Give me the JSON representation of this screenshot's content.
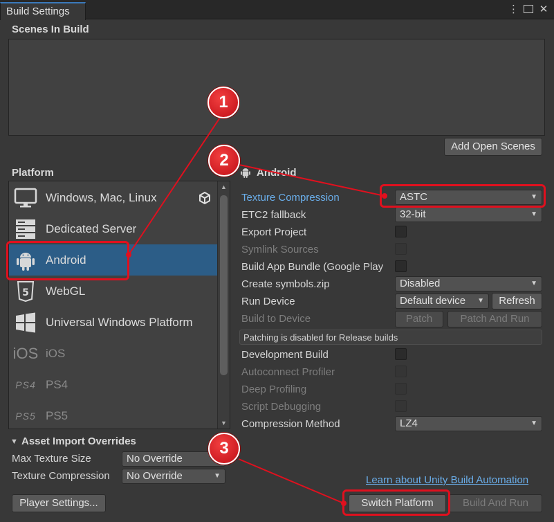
{
  "window": {
    "title": "Build Settings",
    "menu_icon": "kebab-menu-icon",
    "maximize_icon": "maximize-icon",
    "close_icon": "close-icon"
  },
  "scenes": {
    "heading": "Scenes In Build",
    "add_open_scenes": "Add Open Scenes"
  },
  "platform": {
    "heading": "Platform",
    "items": [
      {
        "label": "Windows, Mac, Linux",
        "icon": "monitor-icon",
        "badge": "unity-logo-icon"
      },
      {
        "label": "Dedicated Server",
        "icon": "server-icon"
      },
      {
        "label": "Android",
        "icon": "android-icon",
        "selected": true
      },
      {
        "label": "WebGL",
        "icon": "html5-icon"
      },
      {
        "label": "Universal Windows Platform",
        "icon": "windows-logo-icon"
      },
      {
        "label": "iOS",
        "icon": "ios-icon",
        "icon_text": "iOS",
        "dim": true
      },
      {
        "label": "PS4",
        "icon": "ps4-icon",
        "icon_text": "PS4",
        "dim": true
      },
      {
        "label": "PS5",
        "icon": "ps5-icon",
        "icon_text": "PS5",
        "dim": true
      }
    ]
  },
  "settings": {
    "platform_title": "Android",
    "texture_compression": {
      "label": "Texture Compression",
      "value": "ASTC"
    },
    "etc2_fallback": {
      "label": "ETC2 fallback",
      "value": "32-bit"
    },
    "export_project": {
      "label": "Export Project"
    },
    "symlink_sources": {
      "label": "Symlink Sources"
    },
    "build_app_bundle": {
      "label": "Build App Bundle (Google Play"
    },
    "create_symbols": {
      "label": "Create symbols.zip",
      "value": "Disabled"
    },
    "run_device": {
      "label": "Run Device",
      "value": "Default device",
      "refresh": "Refresh"
    },
    "build_to_device": {
      "label": "Build to Device",
      "patch": "Patch",
      "patch_and_run": "Patch And Run"
    },
    "patching_info": "Patching is disabled for Release builds",
    "development_build": {
      "label": "Development Build"
    },
    "autoconnect_profiler": {
      "label": "Autoconnect Profiler"
    },
    "deep_profiling": {
      "label": "Deep Profiling"
    },
    "script_debugging": {
      "label": "Script Debugging"
    },
    "compression_method": {
      "label": "Compression Method",
      "value": "LZ4"
    }
  },
  "asset_import": {
    "heading": "Asset Import Overrides",
    "max_texture_size": {
      "label": "Max Texture Size",
      "value": "No Override"
    },
    "texture_compression": {
      "label": "Texture Compression",
      "value": "No Override"
    }
  },
  "footer": {
    "learn_link": "Learn about Unity Build Automation",
    "player_settings": "Player Settings...",
    "switch_platform": "Switch Platform",
    "build_and_run": "Build And Run"
  },
  "annotations": {
    "markers": [
      "1",
      "2",
      "3"
    ],
    "color": "#e0101e"
  },
  "colors": {
    "background": "#383838",
    "selection": "#2c5d87",
    "link": "#6aaeea"
  }
}
